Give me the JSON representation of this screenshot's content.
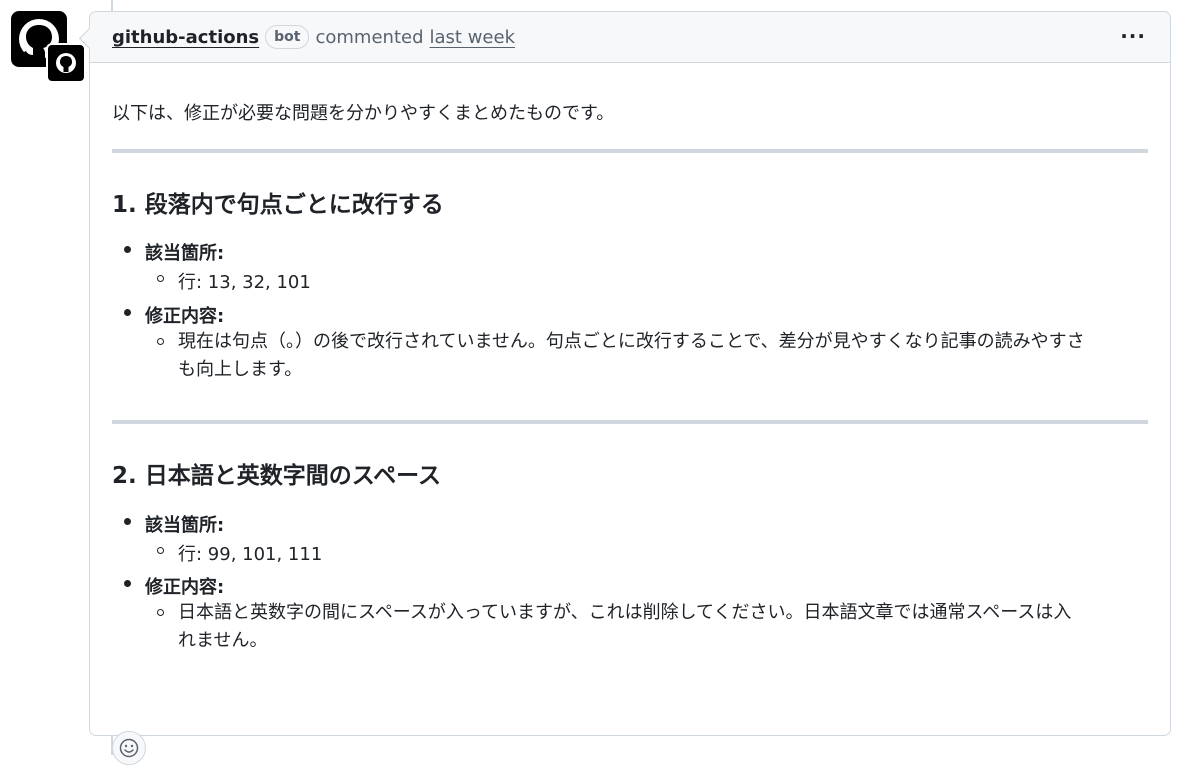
{
  "header": {
    "author": "github-actions",
    "bot_label": "bot",
    "action": "commented",
    "timestamp": "last week",
    "menu_glyph": "···"
  },
  "body": {
    "intro": "以下は、修正が必要な問題を分かりやすくまとめたものです。",
    "sections": [
      {
        "heading": "1. 段落内で句点ごとに改行する",
        "location_label": "該当箇所:",
        "location_value": "行: 13, 32, 101",
        "fix_label": "修正内容:",
        "fix_line1": "現在は句点（。）の後で改行されていません。句点ごとに改行することで、差分が見やすくなり記事の読みやすさ",
        "fix_line2": "も向上します。"
      },
      {
        "heading": "2. 日本語と英数字間のスペース",
        "location_label": "該当箇所:",
        "location_value": "行: 99, 101, 111",
        "fix_label": "修正内容:",
        "fix_line1": "日本語と英数字の間にスペースが入っていますが、これは削除してください。日本語文章では通常スペースは入",
        "fix_line2": "れません。"
      }
    ]
  },
  "icons": {
    "avatar": "github-octocat-icon",
    "badge": "github-octocat-icon",
    "menu": "kebab-icon",
    "reaction": "smiley-icon"
  },
  "colors": {
    "text": "#1f2328",
    "muted": "#59636e",
    "border": "#d0d7de",
    "header_bg": "#f6f8fa"
  }
}
